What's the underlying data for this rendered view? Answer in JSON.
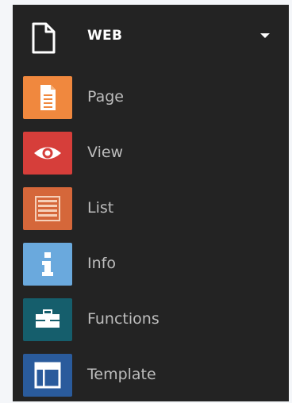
{
  "header": {
    "title": "WEB",
    "icon": "document-icon",
    "dropdown_icon": "caret-down-icon"
  },
  "items": [
    {
      "label": "Page",
      "icon": "page-icon",
      "color": "#f0883e"
    },
    {
      "label": "View",
      "icon": "eye-icon",
      "color": "#d63e3a"
    },
    {
      "label": "List",
      "icon": "list-icon",
      "color": "#d5673a"
    },
    {
      "label": "Info",
      "icon": "info-icon",
      "color": "#6aa9dd"
    },
    {
      "label": "Functions",
      "icon": "toolbox-icon",
      "color": "#155e6c"
    },
    {
      "label": "Template",
      "icon": "template-icon",
      "color": "#2a5b9c"
    }
  ]
}
